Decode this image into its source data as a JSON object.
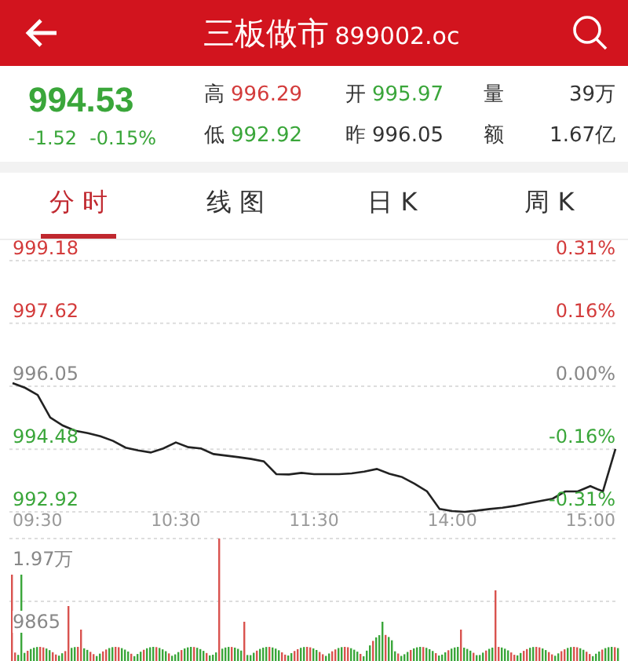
{
  "header": {
    "title": "三板做市",
    "code": "899002.oc"
  },
  "quote": {
    "price": "994.53",
    "change": "-1.52",
    "change_pct": "-0.15%",
    "color": "#3aa63a"
  },
  "stats": [
    {
      "label": "高",
      "value": "996.29",
      "color": "#d33b3b"
    },
    {
      "label": "开",
      "value": "995.97",
      "color": "#3aa63a"
    },
    {
      "label": "量",
      "value": "39万",
      "color": "#333333"
    },
    {
      "label": "低",
      "value": "992.92",
      "color": "#3aa63a"
    },
    {
      "label": "昨",
      "value": "996.05",
      "color": "#333333"
    },
    {
      "label": "额",
      "value": "1.67亿",
      "color": "#333333"
    }
  ],
  "tabs": [
    {
      "label": "分 时",
      "selected": true
    },
    {
      "label": "线 图",
      "selected": false
    },
    {
      "label": "日 K",
      "selected": false
    },
    {
      "label": "周 K",
      "selected": false
    }
  ],
  "chart": {
    "levels": [
      {
        "pct": "0.31%",
        "color": "#d33b3b"
      },
      {
        "pct": "0.16%",
        "color": "#d33b3b"
      },
      {
        "pct": "0.00%",
        "color": "#888888"
      },
      {
        "pct": "-0.16%",
        "color": "#3aa63a"
      },
      {
        "pct": "-0.31%",
        "color": "#3aa63a"
      }
    ],
    "chart_data": {
      "type": "line",
      "categories": [
        null,
        null,
        null,
        null,
        null,
        null,
        null,
        null,
        null,
        null,
        null,
        null,
        null,
        null,
        null,
        null,
        null,
        null,
        null,
        null,
        null,
        null,
        null,
        null,
        null,
        null,
        null,
        null,
        null,
        null,
        null,
        null,
        null,
        null,
        null,
        null,
        null,
        null,
        null,
        null,
        null,
        null,
        null,
        null,
        null,
        null,
        null,
        null,
        null
      ],
      "series": [
        {
          "color": "#222222",
          "values": [
            996.13,
            996.01,
            995.83,
            995.27,
            995.07,
            994.94,
            994.88,
            994.8,
            994.69,
            994.52,
            994.45,
            994.4,
            994.5,
            994.65,
            994.53,
            994.5,
            994.36,
            994.32,
            994.28,
            994.24,
            994.18,
            993.86,
            993.85,
            993.89,
            993.86,
            993.86,
            993.86,
            993.88,
            993.92,
            993.99,
            993.87,
            993.79,
            993.62,
            993.43,
            992.99,
            992.94,
            992.92,
            992.95,
            992.99,
            993.02,
            993.07,
            993.13,
            993.19,
            993.25,
            993.43,
            993.43,
            993.56,
            993.43,
            994.49
          ]
        }
      ],
      "ylim": [
        992.92,
        999.18
      ],
      "grid": true,
      "yticks": [
        {
          "value": 999.18,
          "label": "999.18"
        },
        {
          "value": 997.62,
          "label": "997.62"
        },
        {
          "value": 996.05,
          "label": "996.05"
        },
        {
          "value": 994.48,
          "label": "994.48"
        },
        {
          "value": 992.92,
          "label": "992.92"
        }
      ]
    },
    "time_labels": [
      "09:30",
      "10:30",
      "11:30",
      "14:00",
      "15:00"
    ],
    "volume_labels": [
      "1.97万",
      "9865"
    ]
  }
}
